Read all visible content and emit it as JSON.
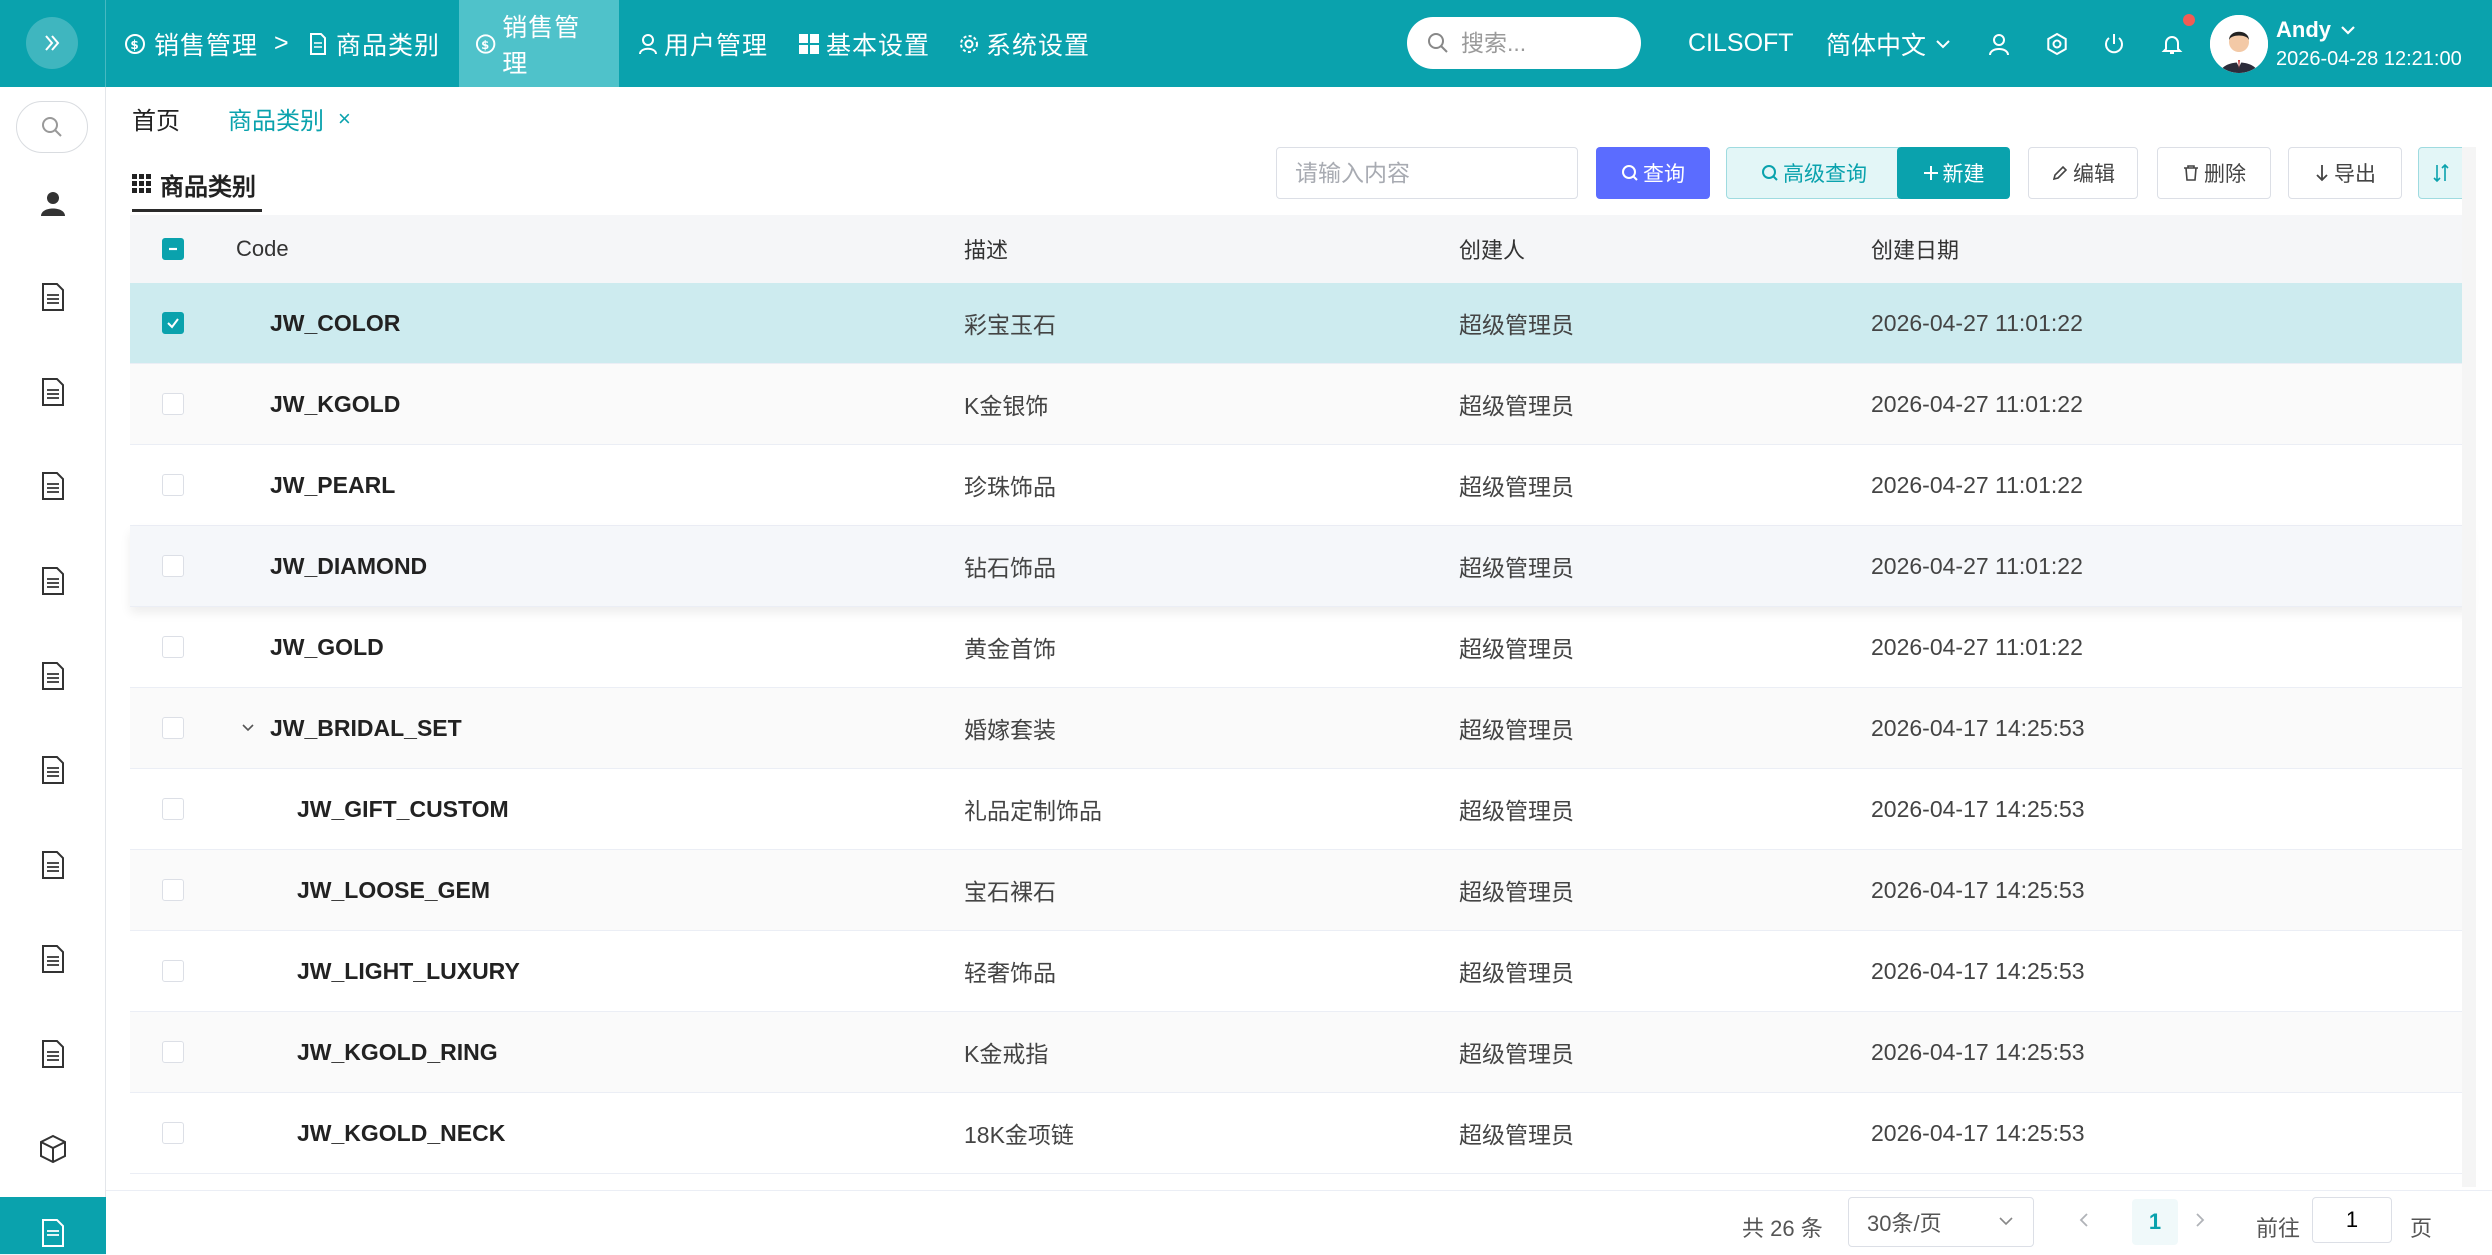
{
  "topbar": {
    "breadcrumb": [
      {
        "label": "销售管理",
        "icon": "dollar-circle-icon"
      },
      {
        "label": "商品类别",
        "icon": "document-icon"
      }
    ],
    "breadcrumb_sep": ">",
    "nav": [
      {
        "label": "销售管理",
        "icon": "dollar-circle-icon",
        "active": true
      },
      {
        "label": "用户管理",
        "icon": "user-icon"
      },
      {
        "label": "基本设置",
        "icon": "grid-icon"
      },
      {
        "label": "系统设置",
        "icon": "gear-icon"
      }
    ],
    "search_placeholder": "搜索...",
    "brand": "CILSOFT",
    "language": "简体中文",
    "user_name": "Andy",
    "datetime": "2026-04-28 12:21:00",
    "accent_color": "#0aa2ad"
  },
  "tabs": {
    "home": "首页",
    "current": "商品类别",
    "close": "×"
  },
  "page": {
    "title": "商品类别",
    "query_placeholder": "请输入内容",
    "buttons": {
      "query": "查询",
      "advanced": "高级查询",
      "new": "新建",
      "edit": "编辑",
      "delete": "删除",
      "export": "导出"
    }
  },
  "table": {
    "columns": [
      "Code",
      "描述",
      "创建人",
      "创建日期"
    ],
    "rows": [
      {
        "code": "JW_COLOR",
        "desc": "彩宝玉石",
        "creator": "超级管理员",
        "date": "2026-04-27 11:01:22",
        "checked": true,
        "level": 0
      },
      {
        "code": "JW_KGOLD",
        "desc": "K金银饰",
        "creator": "超级管理员",
        "date": "2026-04-27 11:01:22",
        "level": 0
      },
      {
        "code": "JW_PEARL",
        "desc": "珍珠饰品",
        "creator": "超级管理员",
        "date": "2026-04-27 11:01:22",
        "level": 0
      },
      {
        "code": "JW_DIAMOND",
        "desc": "钻石饰品",
        "creator": "超级管理员",
        "date": "2026-04-27 11:01:22",
        "level": 0
      },
      {
        "code": "JW_GOLD",
        "desc": "黄金首饰",
        "creator": "超级管理员",
        "date": "2026-04-27 11:01:22",
        "level": 0
      },
      {
        "code": "JW_BRIDAL_SET",
        "desc": "婚嫁套装",
        "creator": "超级管理员",
        "date": "2026-04-17 14:25:53",
        "level": 0,
        "expanded": true
      },
      {
        "code": "JW_GIFT_CUSTOM",
        "desc": "礼品定制饰品",
        "creator": "超级管理员",
        "date": "2026-04-17 14:25:53",
        "level": 1
      },
      {
        "code": "JW_LOOSE_GEM",
        "desc": "宝石裸石",
        "creator": "超级管理员",
        "date": "2026-04-17 14:25:53",
        "level": 1
      },
      {
        "code": "JW_LIGHT_LUXURY",
        "desc": "轻奢饰品",
        "creator": "超级管理员",
        "date": "2026-04-17 14:25:53",
        "level": 1
      },
      {
        "code": "JW_KGOLD_RING",
        "desc": "K金戒指",
        "creator": "超级管理员",
        "date": "2026-04-17 14:25:53",
        "level": 1
      },
      {
        "code": "JW_KGOLD_NECK",
        "desc": "18K金项链",
        "creator": "超级管理员",
        "date": "2026-04-17 14:25:53",
        "level": 1
      }
    ]
  },
  "pagination": {
    "total": "共 26 条",
    "page_size": "30条/页",
    "current_page": "1",
    "goto_label": "前往",
    "goto_value": "1",
    "page_unit": "页"
  }
}
